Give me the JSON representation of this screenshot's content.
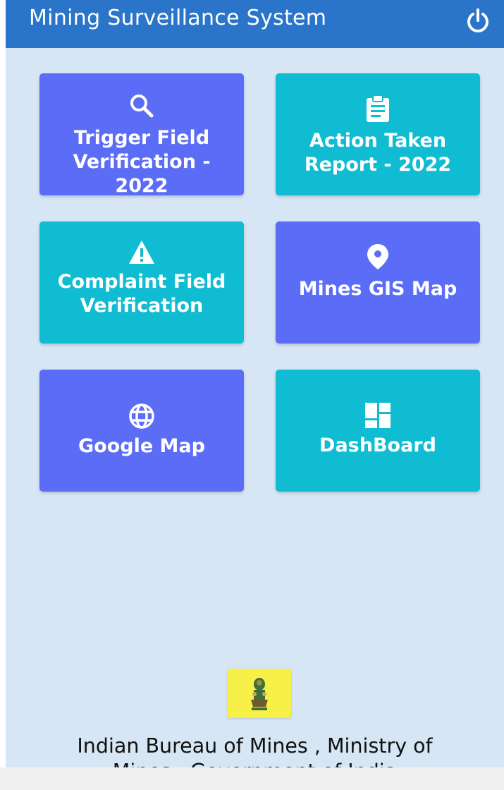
{
  "header": {
    "title": "Mining Surveillance System",
    "power_icon": "power-icon"
  },
  "tiles": [
    {
      "label": "Trigger Field Verification - 2022",
      "icon": "search-icon",
      "color": "#5b6cf6"
    },
    {
      "label": "Action Taken Report - 2022",
      "icon": "clipboard-icon",
      "color": "#10bcd2"
    },
    {
      "label": "Complaint Field Verification",
      "icon": "warning-icon",
      "color": "#10bcd2"
    },
    {
      "label": "Mines GIS Map",
      "icon": "location-pin-icon",
      "color": "#5b6cf6"
    },
    {
      "label": "Google Map",
      "icon": "globe-icon",
      "color": "#5b6cf6"
    },
    {
      "label": "DashBoard",
      "icon": "dashboard-icon",
      "color": "#10bcd2"
    }
  ],
  "footer": {
    "logo_icon": "emblem-icon",
    "line1": "Indian Bureau of Mines , Ministry of",
    "line2": "Mines , Government of India"
  },
  "colors": {
    "appbar": "#2a74c9",
    "background": "#d6e6f4",
    "tile_blue": "#5b6cf6",
    "tile_teal": "#10bcd2",
    "logo_bg": "#f7f046"
  }
}
